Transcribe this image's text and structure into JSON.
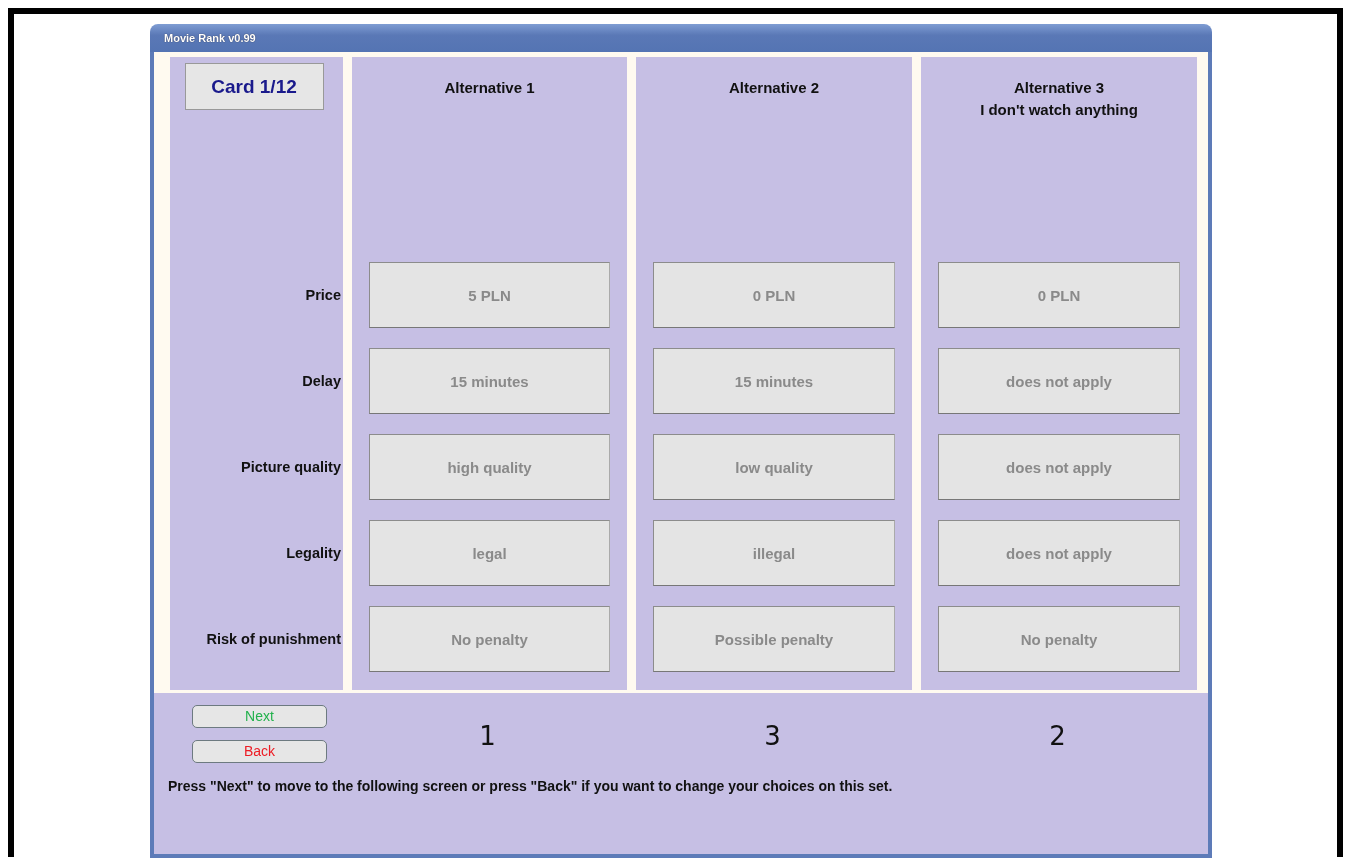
{
  "window": {
    "title": "Movie Rank v0.99"
  },
  "card": "Card 1/12",
  "attributes": [
    "Price",
    "Delay",
    "Picture quality",
    "Legality",
    "Risk of punishment"
  ],
  "alternatives": [
    {
      "title": "Alternative 1",
      "values": [
        "5 PLN",
        "15 minutes",
        "high quality",
        "legal",
        "No penalty"
      ],
      "rank": "1"
    },
    {
      "title": "Alternative 2",
      "values": [
        "0 PLN",
        "15 minutes",
        "low quality",
        "illegal",
        "Possible penalty"
      ],
      "rank": "3"
    },
    {
      "title": "Alternative 3",
      "subtitle": "I don't watch anything",
      "values": [
        "0 PLN",
        "does not apply",
        "does not apply",
        "does not apply",
        "No penalty"
      ],
      "rank": "2"
    }
  ],
  "buttons": [
    {
      "label": "Next",
      "color": "#22b14c"
    },
    {
      "label": "Back",
      "color": "#ed1c24"
    }
  ],
  "instructions": "Press \"Next\" to move to the following screen or press \"Back\" if you want to change your choices on this set."
}
